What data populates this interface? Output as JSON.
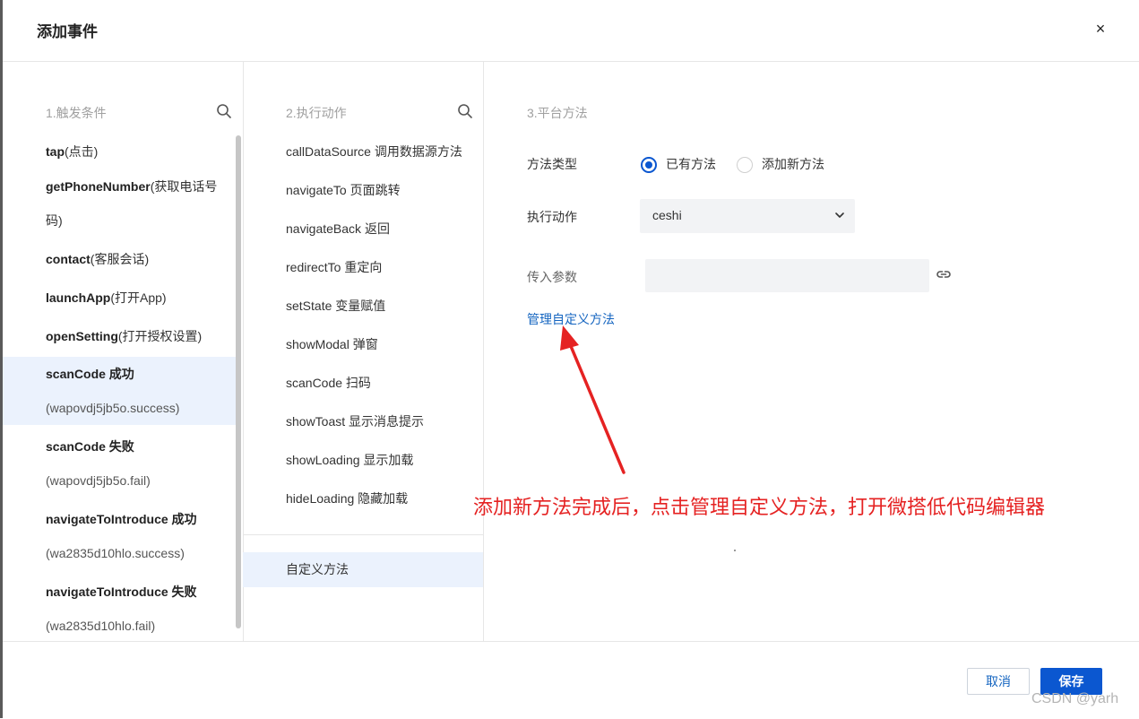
{
  "dialog": {
    "title": "添加事件",
    "close_glyph": "×"
  },
  "trigger": {
    "header": "1.触发条件",
    "items": [
      {
        "name": "tap",
        "desc": "(点击)"
      },
      {
        "name": "getPhoneNumber",
        "desc": "(获取电话号码)"
      },
      {
        "name": "contact",
        "desc": "(客服会话)"
      },
      {
        "name": "launchApp",
        "desc": "(打开App)"
      },
      {
        "name": "openSetting",
        "desc": "(打开授权设置)"
      },
      {
        "name": "scanCode 成功",
        "sub": "(wapovdj5jb5o.success)"
      },
      {
        "name": "scanCode 失败",
        "sub": "(wapovdj5jb5o.fail)"
      },
      {
        "name": "navigateToIntroduce 成功",
        "sub": "(wa2835d10hlo.success)"
      },
      {
        "name": "navigateToIntroduce 失败",
        "sub": "(wa2835d10hlo.fail)"
      }
    ]
  },
  "action": {
    "header": "2.执行动作",
    "items": [
      "callDataSource 调用数据源方法",
      "navigateTo 页面跳转",
      "navigateBack 返回",
      "redirectTo 重定向",
      "setState 变量赋值",
      "showModal 弹窗",
      "scanCode 扫码",
      "showToast 显示消息提示",
      "showLoading 显示加载",
      "hideLoading 隐藏加载"
    ],
    "custom": "自定义方法"
  },
  "platform": {
    "header": "3.平台方法",
    "method_type_label": "方法类型",
    "radio_existing": "已有方法",
    "radio_new": "添加新方法",
    "exec_label": "执行动作",
    "exec_value": "ceshi",
    "param_label": "传入参数",
    "param_value": "",
    "manage_link": "管理自定义方法"
  },
  "annotation": {
    "text": "添加新方法完成后，点击管理自定义方法，打开微搭低代码编辑器",
    "color": "#e52222"
  },
  "footer": {
    "cancel": "取消",
    "save": "保存"
  },
  "watermark": "CSDN @yarh",
  "colors": {
    "primary": "#0b57d0",
    "link": "#1565c0",
    "selected_bg": "#ebf2fd"
  }
}
